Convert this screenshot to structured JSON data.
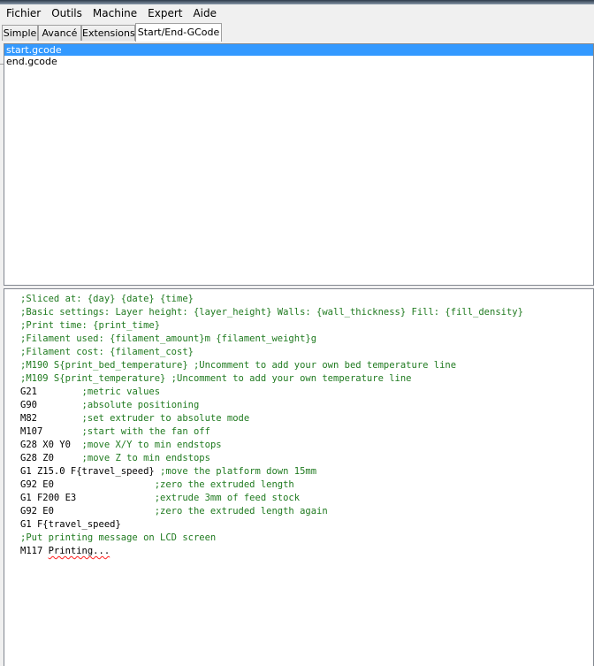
{
  "menubar": {
    "items": [
      "Fichier",
      "Outils",
      "Machine",
      "Expert",
      "Aide"
    ]
  },
  "tabs": {
    "items": [
      "Simple",
      "Avancé",
      "Extensions",
      "Start/End-GCode"
    ],
    "active": "Start/End-GCode"
  },
  "files": {
    "items": [
      "start.gcode",
      "end.gcode"
    ],
    "selected": "start.gcode"
  },
  "editor": {
    "lines": [
      {
        "cmd": "",
        "comment": ";Sliced at: {day} {date} {time}"
      },
      {
        "cmd": "",
        "comment": ";Basic settings: Layer height: {layer_height} Walls: {wall_thickness} Fill: {fill_density}"
      },
      {
        "cmd": "",
        "comment": ";Print time: {print_time}"
      },
      {
        "cmd": "",
        "comment": ";Filament used: {filament_amount}m {filament_weight}g"
      },
      {
        "cmd": "",
        "comment": ";Filament cost: {filament_cost}"
      },
      {
        "cmd": "",
        "comment": ";M190 S{print_bed_temperature} ;Uncomment to add your own bed temperature line"
      },
      {
        "cmd": "",
        "comment": ";M109 S{print_temperature} ;Uncomment to add your own temperature line"
      },
      {
        "cmd": "G21        ",
        "comment": ";metric values"
      },
      {
        "cmd": "G90        ",
        "comment": ";absolute positioning"
      },
      {
        "cmd": "M82        ",
        "comment": ";set extruder to absolute mode"
      },
      {
        "cmd": "M107       ",
        "comment": ";start with the fan off"
      },
      {
        "cmd": "G28 X0 Y0  ",
        "comment": ";move X/Y to min endstops"
      },
      {
        "cmd": "G28 Z0     ",
        "comment": ";move Z to min endstops"
      },
      {
        "cmd": "G1 Z15.0 F{travel_speed} ",
        "comment": ";move the platform down 15mm"
      },
      {
        "cmd": "G92 E0                  ",
        "comment": ";zero the extruded length"
      },
      {
        "cmd": "G1 F200 E3              ",
        "comment": ";extrude 3mm of feed stock"
      },
      {
        "cmd": "G92 E0                  ",
        "comment": ";zero the extruded length again"
      },
      {
        "cmd": "G1 F{travel_speed}",
        "comment": ""
      },
      {
        "cmd": "",
        "comment": ";Put printing message on LCD screen"
      }
    ],
    "last_line": {
      "cmd": "M117 ",
      "word": "Printing..."
    }
  }
}
